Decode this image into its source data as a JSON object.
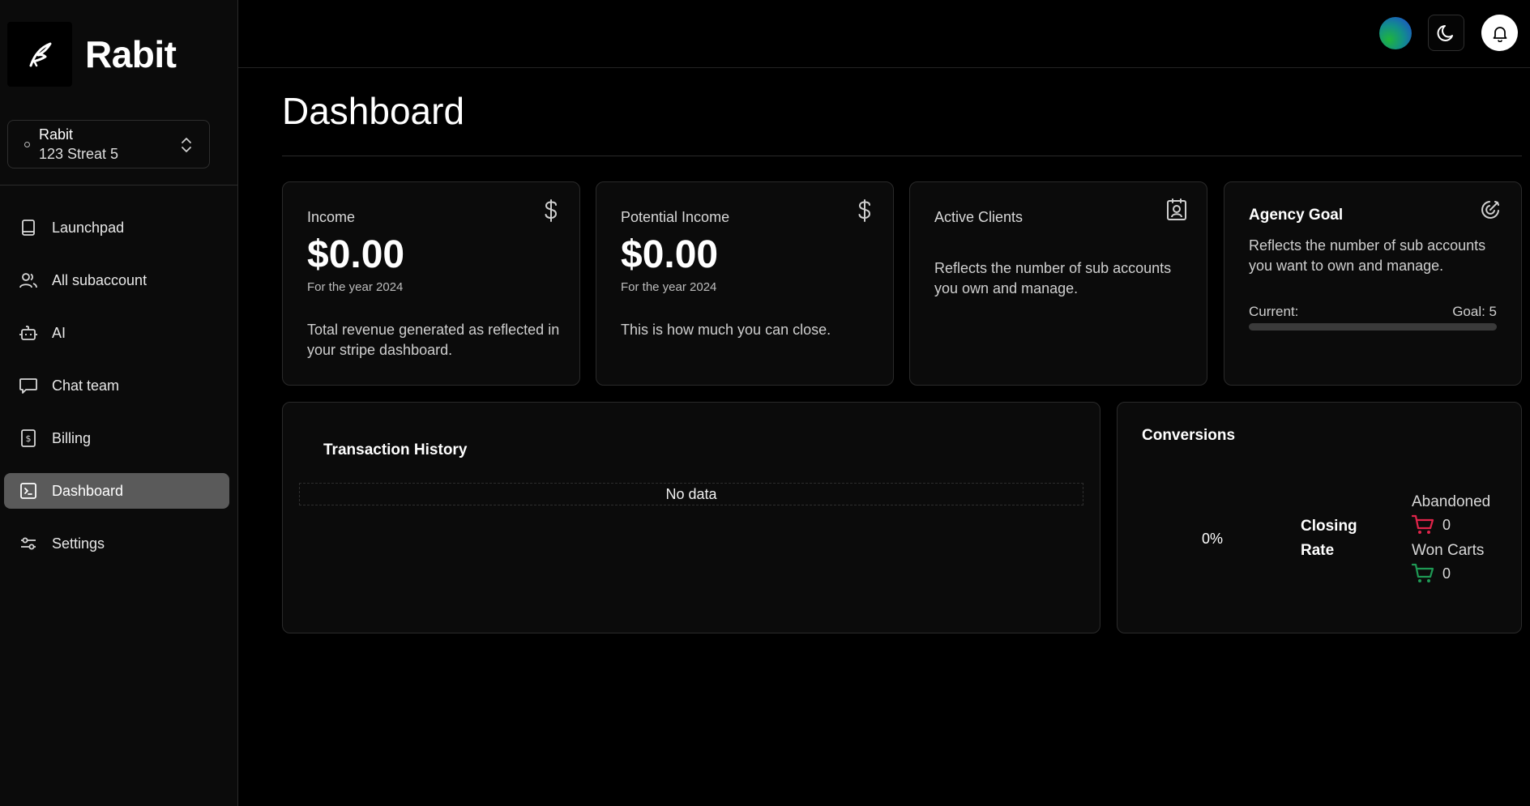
{
  "brand": {
    "name": "Rabit"
  },
  "account": {
    "name": "Rabit",
    "address": "123 Streat 5"
  },
  "sidebar": {
    "items": [
      {
        "label": "Launchpad",
        "icon": "book-icon"
      },
      {
        "label": "All subaccount",
        "icon": "users-icon"
      },
      {
        "label": "AI",
        "icon": "bot-icon"
      },
      {
        "label": "Chat team",
        "icon": "chat-icon"
      },
      {
        "label": "Billing",
        "icon": "receipt-icon"
      },
      {
        "label": "Dashboard",
        "icon": "terminal-icon",
        "active": true
      },
      {
        "label": "Settings",
        "icon": "sliders-icon"
      }
    ]
  },
  "page": {
    "title": "Dashboard"
  },
  "cards": {
    "income": {
      "label": "Income",
      "value": "$0.00",
      "sub": "For the year 2024",
      "desc": "Total revenue generated as reflected in your stripe dashboard."
    },
    "potential": {
      "label": "Potential Income",
      "value": "$0.00",
      "sub": "For the year 2024",
      "desc": "This is how much you can close."
    },
    "clients": {
      "label": "Active Clients",
      "desc": "Reflects the number of sub accounts you own and manage."
    },
    "goal": {
      "title": "Agency Goal",
      "desc": "Reflects the number of sub accounts you want to own and manage.",
      "current_label": "Current:",
      "goal_label": "Goal: 5",
      "progress": 0
    }
  },
  "transactions": {
    "title": "Transaction History",
    "empty": "No data"
  },
  "conversions": {
    "title": "Conversions",
    "percent": "0%",
    "rate_label": "Closing Rate",
    "abandoned_label": "Abandoned",
    "abandoned_value": "0",
    "won_label": "Won Carts",
    "won_value": "0"
  },
  "colors": {
    "abandoned": "#e0244a",
    "won": "#1f9a55",
    "active_nav": "#5a5a5a"
  }
}
